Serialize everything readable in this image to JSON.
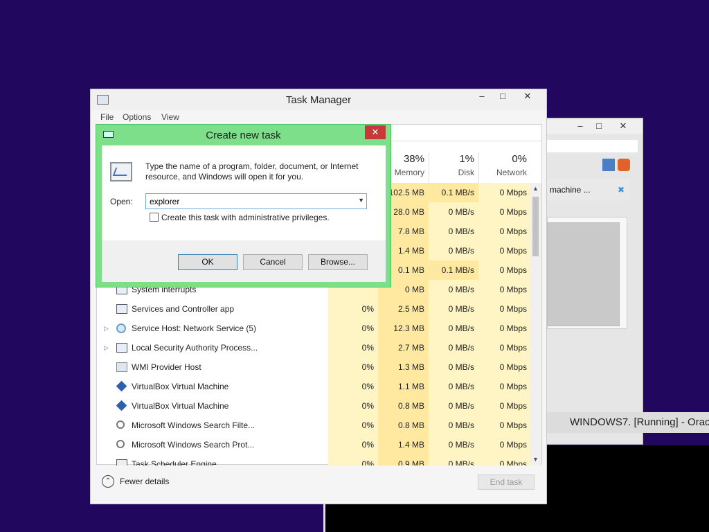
{
  "background_window": {
    "item_label": "machine ...",
    "bottom_title": "WINDOWS7. [Running] - Oracl"
  },
  "task_manager": {
    "title": "Task Manager",
    "menu": [
      "File",
      "Options",
      "View"
    ],
    "columns": {
      "memory": {
        "pct": "38%",
        "label": "Memory"
      },
      "disk": {
        "pct": "1%",
        "label": "Disk"
      },
      "network": {
        "pct": "0%",
        "label": "Network"
      }
    },
    "rows": [
      {
        "name": "",
        "cpu": "",
        "memory": "102.5 MB",
        "disk": "0.1 MB/s",
        "network": "0 Mbps",
        "icon": "none",
        "expandable": false
      },
      {
        "name": "",
        "cpu": "",
        "memory": "28.0 MB",
        "disk": "0 MB/s",
        "network": "0 Mbps",
        "icon": "none",
        "expandable": false
      },
      {
        "name": "",
        "cpu": "",
        "memory": "7.8 MB",
        "disk": "0 MB/s",
        "network": "0 Mbps",
        "icon": "none",
        "expandable": false
      },
      {
        "name": "",
        "cpu": "",
        "memory": "1.4 MB",
        "disk": "0 MB/s",
        "network": "0 Mbps",
        "icon": "none",
        "expandable": false
      },
      {
        "name": "",
        "cpu": "",
        "memory": "0.1 MB",
        "disk": "0.1 MB/s",
        "network": "0 Mbps",
        "icon": "none",
        "expandable": false
      },
      {
        "name": "System interrupts",
        "cpu": "",
        "memory": "0 MB",
        "disk": "0 MB/s",
        "network": "0 Mbps",
        "icon": "app-icon",
        "expandable": false
      },
      {
        "name": "Services and Controller app",
        "cpu": "0%",
        "memory": "2.5 MB",
        "disk": "0 MB/s",
        "network": "0 Mbps",
        "icon": "app-icon",
        "expandable": false
      },
      {
        "name": "Service Host: Network Service (5)",
        "cpu": "0%",
        "memory": "12.3 MB",
        "disk": "0 MB/s",
        "network": "0 Mbps",
        "icon": "gear-icon",
        "expandable": true
      },
      {
        "name": "Local Security Authority Process...",
        "cpu": "0%",
        "memory": "2.7 MB",
        "disk": "0 MB/s",
        "network": "0 Mbps",
        "icon": "app-icon",
        "expandable": true
      },
      {
        "name": "WMI Provider Host",
        "cpu": "0%",
        "memory": "1.3 MB",
        "disk": "0 MB/s",
        "network": "0 Mbps",
        "icon": "wmi-icon",
        "expandable": false
      },
      {
        "name": "VirtualBox Virtual Machine",
        "cpu": "0%",
        "memory": "1.1 MB",
        "disk": "0 MB/s",
        "network": "0 Mbps",
        "icon": "virtualbox-icon",
        "expandable": false
      },
      {
        "name": "VirtualBox Virtual Machine",
        "cpu": "0%",
        "memory": "0.8 MB",
        "disk": "0 MB/s",
        "network": "0 Mbps",
        "icon": "virtualbox-icon",
        "expandable": false
      },
      {
        "name": "Microsoft Windows Search Filte...",
        "cpu": "0%",
        "memory": "0.8 MB",
        "disk": "0 MB/s",
        "network": "0 Mbps",
        "icon": "search-icon",
        "expandable": false
      },
      {
        "name": "Microsoft Windows Search Prot...",
        "cpu": "0%",
        "memory": "1.4 MB",
        "disk": "0 MB/s",
        "network": "0 Mbps",
        "icon": "search-icon",
        "expandable": false
      },
      {
        "name": "Task Scheduler Engine",
        "cpu": "0%",
        "memory": "0.9 MB",
        "disk": "0 MB/s",
        "network": "0 Mbps",
        "icon": "task-icon",
        "expandable": false
      }
    ],
    "fewer_details": "Fewer details",
    "end_task": "End task"
  },
  "dialog": {
    "title": "Create new task",
    "description": "Type the name of a program, folder, document, or Internet resource, and Windows will open it for you.",
    "open_label": "Open:",
    "open_value": "explorer",
    "admin_checkbox_label": "Create this task with administrative privileges.",
    "admin_checked": false,
    "ok": "OK",
    "cancel": "Cancel",
    "browse": "Browse..."
  }
}
